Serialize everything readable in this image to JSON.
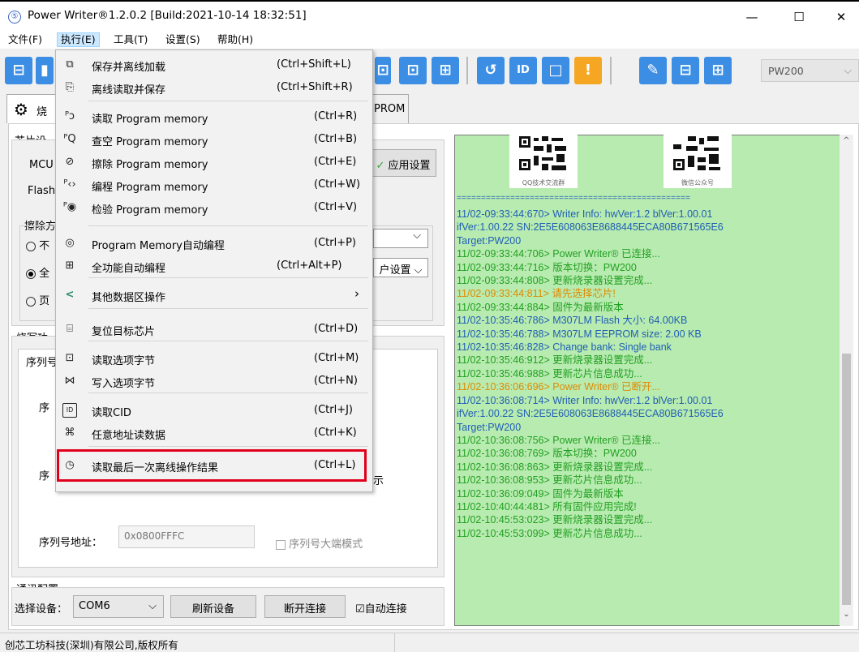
{
  "window": {
    "title": "Power Writer®1.2.0.2 [Build:2021-10-14 18:32:51]",
    "logo_glyph": "⑤",
    "minimize": "—",
    "maximize": "☐",
    "close": "✕"
  },
  "menubar": [
    "文件(F)",
    "执行(E)",
    "工具(T)",
    "设置(S)",
    "帮助(H)"
  ],
  "toolbar": {
    "left_buttons": [
      "⊟",
      "▮"
    ],
    "right_buttons": [
      "⊡",
      "⊡",
      "⊞",
      "↺",
      "ID",
      "□",
      "!",
      "✎",
      "⊟",
      "⊞"
    ],
    "device_combo": "PW200",
    "accent_color": "#3c8ee4"
  },
  "tabs": {
    "first_glyph": "⚙",
    "first_label": "烧",
    "eeprom_label": "PROM"
  },
  "chip_settings": {
    "group_label": "芯片设",
    "mcu_label": "MCU",
    "flash_label": "Flash",
    "apply_button": "应用设置",
    "erase_label": "擦除方",
    "option_none": "不",
    "option_full": "全",
    "option_page": "页",
    "dropdown_glyph": "⌵",
    "user_settings_combo": "户设置"
  },
  "program_group": {
    "label": "烧写功",
    "tab_serial": "序列号",
    "serial_label_1": "序",
    "serial_label_2": "序",
    "display_fragment": "示",
    "serial_addr_label": "序列号地址：",
    "serial_addr_value": "0x0800FFFC",
    "big_endian_label": "序列号大端模式"
  },
  "comm": {
    "group_label": "通讯配置",
    "device_label": "选择设备：",
    "device_value": "COM6",
    "refresh_button": "刷新设备",
    "disconnect_button": "断开连接",
    "auto_connect_label": "自动连接",
    "auto_connect_checked": "☑"
  },
  "log": {
    "qr_left_caption": "QQ技术交流群",
    "qr_right_caption": "微信公众号",
    "separator": "================================================",
    "lines": [
      {
        "text": "11/02-09:33:44:670> Writer Info:  hwVer:1.2  blVer:1.00.01",
        "color": "#1f5fb4"
      },
      {
        "text": "ifVer:1.00.22  SN:2E5E608063E8688445ECA80B671565E6",
        "color": "#1f5fb4"
      },
      {
        "text": "Target:PW200",
        "color": "#1f5fb4"
      },
      {
        "text": "11/02-09:33:44:706> Power Writer® 已连接...",
        "color": "#22a022"
      },
      {
        "text": "11/02-09:33:44:716> 版本切换：PW200",
        "color": "#22a022"
      },
      {
        "text": "11/02-09:33:44:808> 更新烧录器设置完成...",
        "color": "#22a022"
      },
      {
        "text": "11/02-09:33:44:811> 请先选择芯片!",
        "color": "#e08a00"
      },
      {
        "text": "11/02-09:33:44:884> 固件为最新版本",
        "color": "#22a022"
      },
      {
        "text": "11/02-10:35:46:786> M307LM Flash 大小: 64.00KB",
        "color": "#1f5fb4"
      },
      {
        "text": "11/02-10:35:46:788> M307LM EEPROM size: 2.00 KB",
        "color": "#1f5fb4"
      },
      {
        "text": "11/02-10:35:46:828> Change bank: Single bank",
        "color": "#1f5fb4"
      },
      {
        "text": "11/02-10:35:46:912> 更新烧录器设置完成...",
        "color": "#22a022"
      },
      {
        "text": "11/02-10:35:46:988> 更新芯片信息成功...",
        "color": "#22a022"
      },
      {
        "text": "11/02-10:36:06:696> Power Writer® 已断开...",
        "color": "#e08a00"
      },
      {
        "text": "11/02-10:36:08:714> Writer Info:  hwVer:1.2  blVer:1.00.01",
        "color": "#1f5fb4"
      },
      {
        "text": "ifVer:1.00.22  SN:2E5E608063E8688445ECA80B671565E6",
        "color": "#1f5fb4"
      },
      {
        "text": "Target:PW200",
        "color": "#1f5fb4"
      },
      {
        "text": "11/02-10:36:08:756> Power Writer® 已连接...",
        "color": "#22a022"
      },
      {
        "text": "11/02-10:36:08:769> 版本切换：PW200",
        "color": "#22a022"
      },
      {
        "text": "11/02-10:36:08:863> 更新烧录器设置完成...",
        "color": "#22a022"
      },
      {
        "text": "11/02-10:36:08:953> 更新芯片信息成功...",
        "color": "#22a022"
      },
      {
        "text": "11/02-10:36:09:049> 固件为最新版本",
        "color": "#22a022"
      },
      {
        "text": "11/02-10:40:44:481> 所有固件应用完成!",
        "color": "#22a022"
      },
      {
        "text": "11/02-10:45:53:023> 更新烧录器设置完成...",
        "color": "#22a022"
      },
      {
        "text": "11/02-10:45:53:099> 更新芯片信息成功...",
        "color": "#22a022"
      }
    ]
  },
  "status_bar": "创芯工坊科技(深圳)有限公司,版权所有",
  "exec_menu": [
    {
      "icon": "⧉",
      "label": "保存并离线加载",
      "shortcut": "(Ctrl+Shift+L)"
    },
    {
      "icon": "⎘",
      "label": "离线读取并保存",
      "shortcut": "(Ctrl+Shift+R)"
    },
    {
      "icon": "ᴾↄ",
      "label": "读取 Program memory",
      "shortcut": "(Ctrl+R)"
    },
    {
      "icon": "ᴾQ",
      "label": "查空 Program memory",
      "shortcut": "(Ctrl+B)"
    },
    {
      "icon": "⊘",
      "label": "擦除 Program memory",
      "shortcut": "(Ctrl+E)"
    },
    {
      "icon": "ᴾ‹›",
      "label": "编程 Program memory",
      "shortcut": "(Ctrl+W)"
    },
    {
      "icon": "ᴾ◉",
      "label": "检验 Program memory",
      "shortcut": "(Ctrl+V)"
    },
    {
      "icon": "◎",
      "label": "Program Memory自动编程",
      "shortcut": "(Ctrl+P)"
    },
    {
      "icon": "⊞",
      "label": "全功能自动编程",
      "shortcut": "(Ctrl+Alt+P)"
    },
    {
      "icon": "<",
      "label": "其他数据区操作",
      "shortcut": "›"
    },
    {
      "icon": "⌸",
      "label": "复位目标芯片",
      "shortcut": "(Ctrl+D)"
    },
    {
      "icon": "⊡",
      "label": "读取选项字节",
      "shortcut": "(Ctrl+M)"
    },
    {
      "icon": "⋈",
      "label": "写入选项字节",
      "shortcut": "(Ctrl+N)"
    },
    {
      "icon": "ID",
      "label": "读取CID",
      "shortcut": "(Ctrl+J)"
    },
    {
      "icon": "⌘",
      "label": "任意地址读数据",
      "shortcut": "(Ctrl+K)"
    },
    {
      "icon": "◷",
      "label": "读取最后一次离线操作结果",
      "shortcut": "(Ctrl+L)"
    }
  ]
}
